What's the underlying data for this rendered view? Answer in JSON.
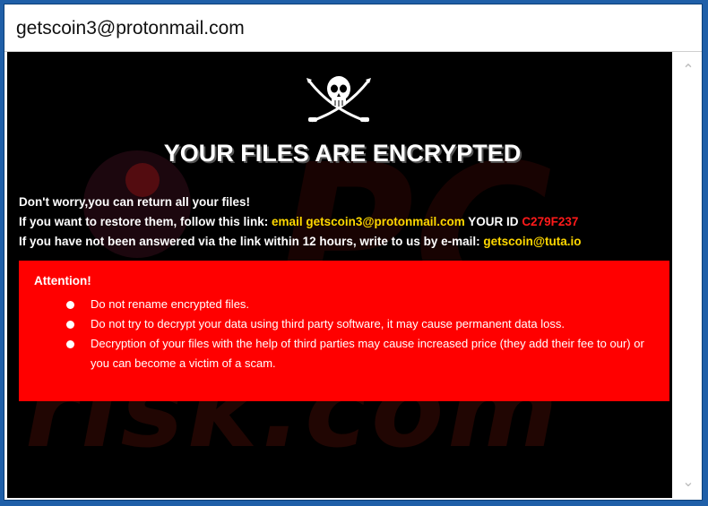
{
  "window": {
    "title": "getscoin3@protonmail.com"
  },
  "watermark": {
    "text": "risk.com",
    "mark": "PC"
  },
  "note": {
    "headline": "YOUR FILES ARE ENCRYPTED",
    "line1": "Don't worry,you can return all your files!",
    "line2_prefix": "If you want to restore them, follow this link:",
    "line2_email": "email getscoin3@protonmail.com",
    "line2_id_label": "YOUR ID",
    "line2_id": "C279F237",
    "line3_prefix": "If you have not been answered via the link within 12 hours, write to us by e-mail:",
    "line3_email": "getscoin@tuta.io"
  },
  "attention": {
    "title": "Attention!",
    "items": [
      "Do not rename encrypted files.",
      "Do not try to decrypt your data using third party software, it may cause permanent data loss.",
      "Decryption of your files with the help of third parties may cause increased price (they add their fee to our) or you can become a victim of a scam."
    ]
  },
  "icons": {
    "logo": "skull-crossed-swords-icon",
    "scroll_up": "chevron-up-icon",
    "scroll_down": "chevron-down-icon"
  },
  "colors": {
    "background": "#000000",
    "attention_box": "#ff0000",
    "highlight": "#ffd800",
    "id_color": "#ff1a1a",
    "frame": "#1f5fa8"
  }
}
